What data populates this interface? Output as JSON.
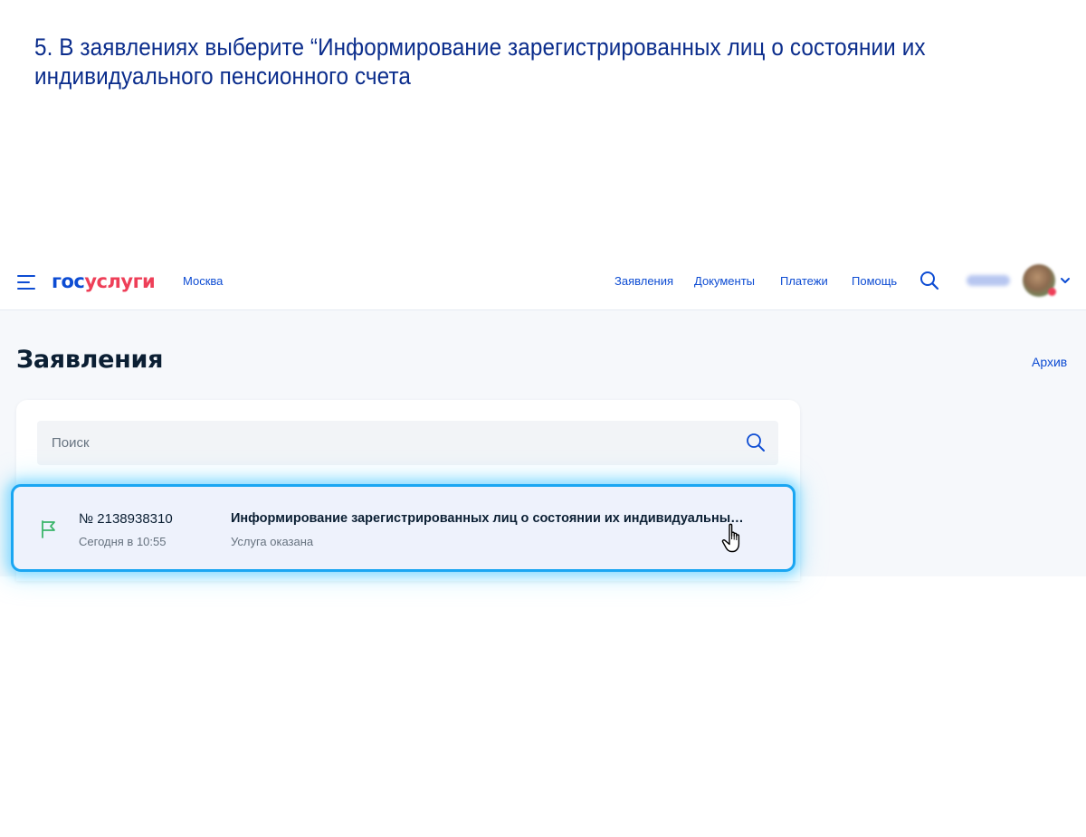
{
  "instruction": {
    "text": "5. В заявлениях выберите “Информирование зарегистрированных лиц о состоянии их индивидуального пенсионного счета"
  },
  "header": {
    "logo_part1": "гос",
    "logo_part2": "услуги",
    "city": "Москва",
    "nav": [
      {
        "label": "Заявления"
      },
      {
        "label": "Документы"
      },
      {
        "label": "Платежи"
      },
      {
        "label": "Помощь"
      }
    ],
    "icons": {
      "menu": "menu-icon",
      "search": "search-icon",
      "avatar_chevron": "chevron-down-icon"
    }
  },
  "main": {
    "title": "Заявления",
    "archive_link": "Архив",
    "search": {
      "placeholder": "Поиск",
      "value": ""
    },
    "applications": [
      {
        "number": "№ 2138938310",
        "date": "Сегодня в 10:55",
        "title": "Информирование зарегистрированных лиц о состоянии их индивидуальных...",
        "status": "Услуга оказана",
        "icon": "flag-icon"
      }
    ]
  },
  "colors": {
    "brand_blue": "#0d4cd3",
    "brand_red": "#ee3f58",
    "instruction_text": "#0b2d8c",
    "highlight_border": "#1aa6f2",
    "success_green": "#3ab56a",
    "page_background": "#f6f8fb"
  }
}
